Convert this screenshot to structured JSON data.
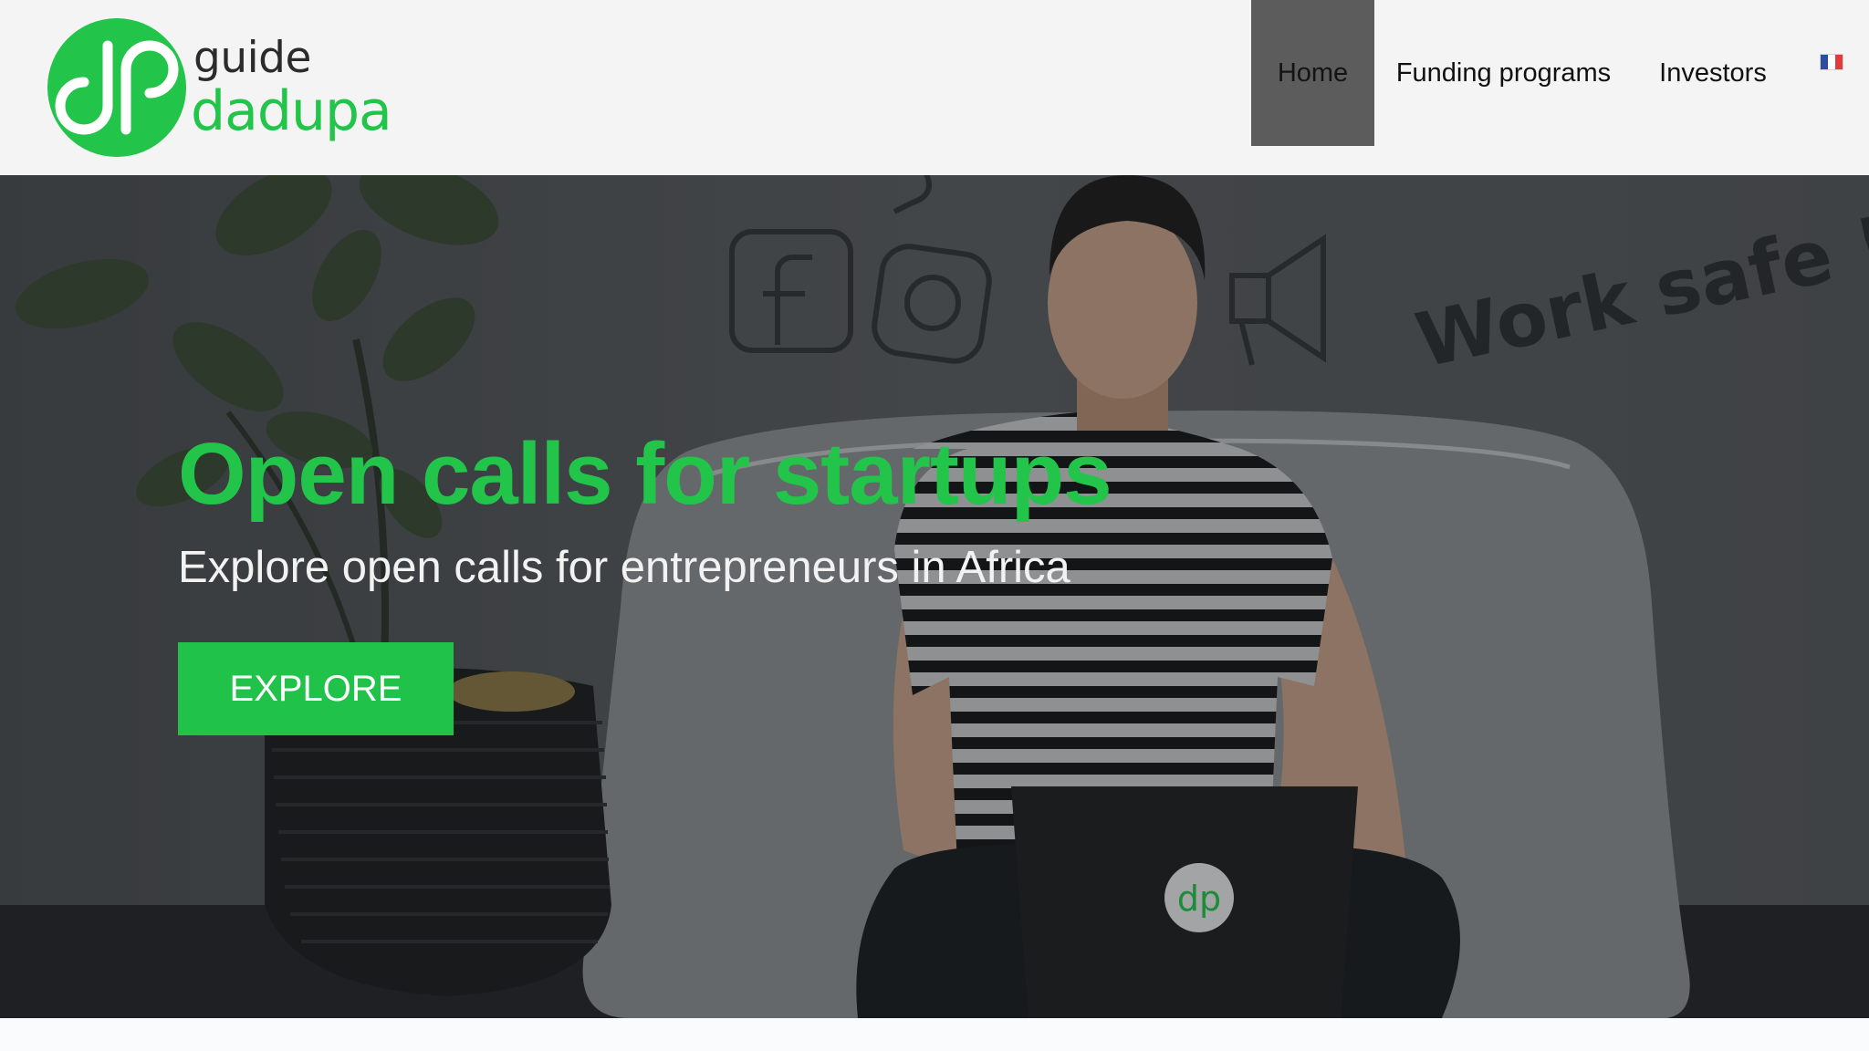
{
  "brand": {
    "logo_mark": "dp",
    "logo_guide": "guide",
    "logo_dadupa": "dadupa",
    "green": "#22c44a"
  },
  "nav": {
    "items": [
      {
        "label": "Home",
        "active": true
      },
      {
        "label": "Funding programs",
        "active": false
      },
      {
        "label": "Investors",
        "active": false
      }
    ],
    "language_icon": "france-flag-icon"
  },
  "hero": {
    "title": "Open calls for startups",
    "subtitle": "Explore open calls for entrepreneurs in Africa",
    "button_label": "EXPLORE",
    "background_text": "Work safe !",
    "laptop_logo": "dp",
    "title_color": "#22c44a",
    "button_color": "#20c249"
  }
}
